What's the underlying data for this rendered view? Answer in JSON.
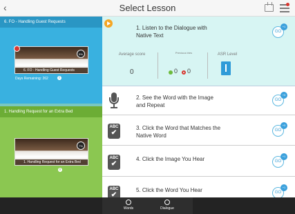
{
  "header": {
    "title": "Select Lesson",
    "back_glyph": "‹"
  },
  "units": [
    {
      "title": "6. FO - Handling Guest Requests",
      "card_caption": "6. FO - Handling Guest Requests",
      "progress": "5%",
      "days_remaining": "Days Remaining: 262",
      "color": "#39b1e0"
    },
    {
      "title": "1. Handling Request for an Extra Bed",
      "card_caption": "1. Handling Request for an Extra Bed",
      "progress": "7%",
      "color": "#8bc751"
    }
  ],
  "lessons": [
    {
      "label": "1. Listen to the Dialogue with Native Text",
      "go": "GO",
      "badge": "+1",
      "icon": "play-icon"
    },
    {
      "label": "2. See the Word with the Image and Repeat",
      "go": "GO",
      "badge": "+3",
      "icon": "microphone-icon"
    },
    {
      "label": "3. Click the Word that Matches the Native Word",
      "go": "GO",
      "badge": "+3",
      "icon": "abc-check-icon"
    },
    {
      "label": "4. Click the Image You Hear",
      "go": "GO",
      "badge": "+1",
      "icon": "abc-check-icon"
    },
    {
      "label": "5. Click the Word You Hear",
      "go": "GO",
      "badge": "+1",
      "icon": "abc-check-icon"
    }
  ],
  "stats": {
    "average_score_label": "Average score",
    "average_score_value": "0",
    "previous_tries_label": "Previous tries",
    "correct_count": "0",
    "wrong_count": "0",
    "asr_level_label": "ASR Level"
  },
  "abc_text": "ABC",
  "bottom_tabs": [
    {
      "label": "Words",
      "icon": "words-icon"
    },
    {
      "label": "Dialogue",
      "icon": "dialogue-icon"
    }
  ]
}
